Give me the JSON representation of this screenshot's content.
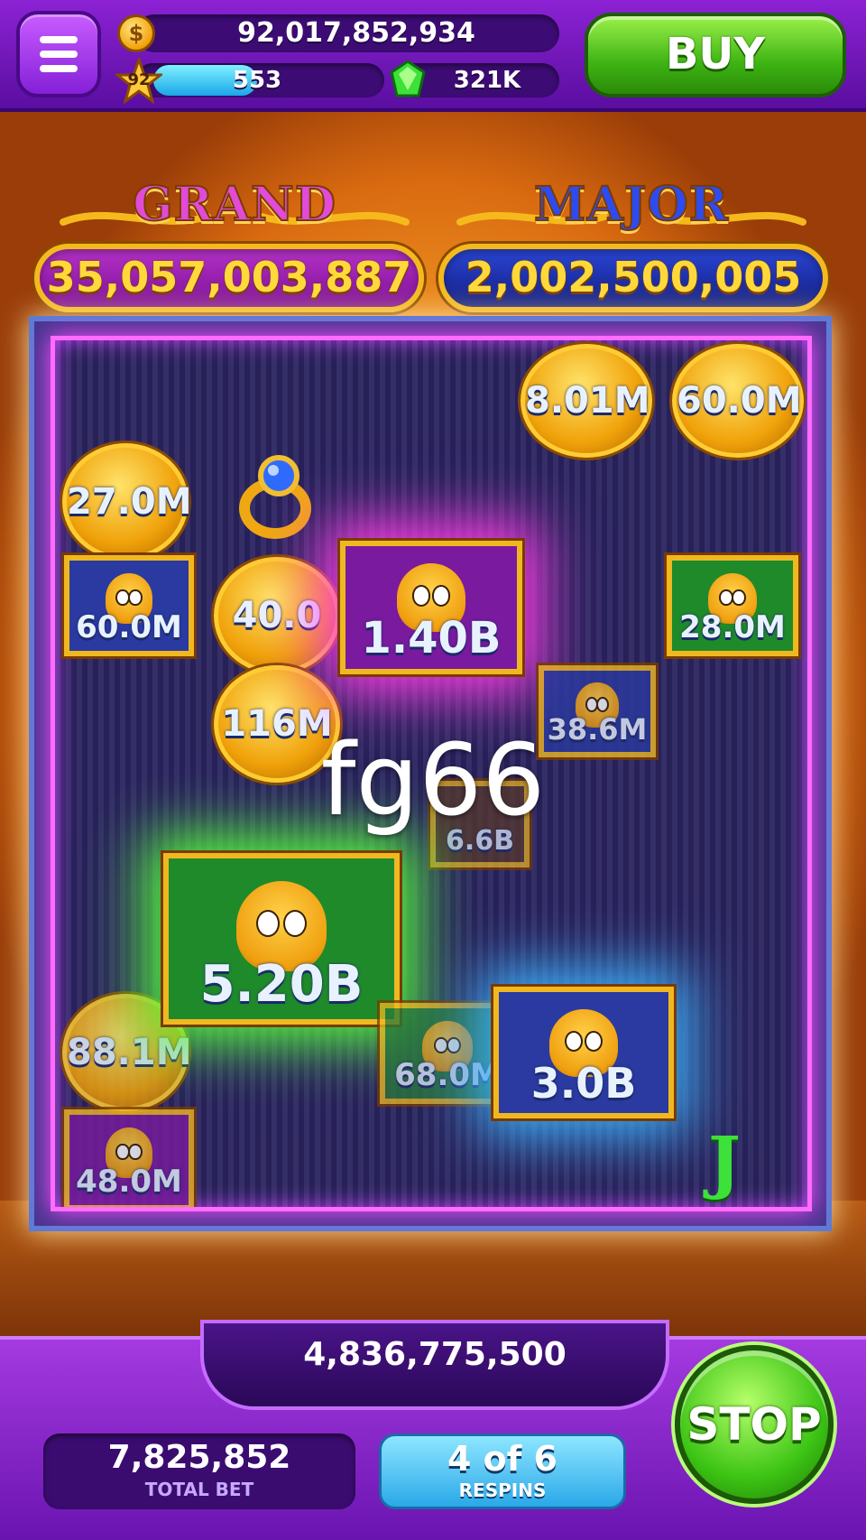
{
  "header": {
    "menu_icon": "hamburger-menu-icon",
    "coin_icon": "coin-icon",
    "coin_symbol": "$",
    "coins": "92,017,852,934",
    "level": "92",
    "xp": "553",
    "xp_progress": 0.45,
    "gem_icon": "green-gem-icon",
    "gems": "321K",
    "buy_label": "BUY"
  },
  "jackpots": {
    "grand_title": "GRAND",
    "grand_value": "35,057,003,887",
    "major_title": "MAJOR",
    "major_value": "2,002,500,005"
  },
  "grid": {
    "coins": [
      {
        "value": "8.01M"
      },
      {
        "value": "60.0M"
      },
      {
        "value": "27.0M"
      },
      {
        "value": "40.0"
      },
      {
        "value": "116M"
      },
      {
        "value": "88.1M"
      }
    ],
    "tiles": [
      {
        "value": "60.0M",
        "character": "wizard"
      },
      {
        "value": "1.40B",
        "character": "queen"
      },
      {
        "value": "28.0M",
        "character": "knight"
      },
      {
        "value": "38.6M",
        "character": "wizard"
      },
      {
        "value": "6.6B",
        "character": "mixed"
      },
      {
        "value": "5.20B",
        "character": "knight"
      },
      {
        "value": "68.0M",
        "character": "queen"
      },
      {
        "value": "3.0B",
        "character": "wizard"
      },
      {
        "value": "48.0M",
        "character": "queen"
      }
    ],
    "ring_icon": "sapphire-ring-icon",
    "j_symbol": "J",
    "watermark": "fg66"
  },
  "footer": {
    "win_amount": "4,836,775,500",
    "total_bet_value": "7,825,852",
    "total_bet_label": "TOTAL BET",
    "respins_value": "4 of 6",
    "respins_label": "RESPINS",
    "stop_label": "STOP"
  },
  "colors": {
    "grand": "#b432c8",
    "major": "#2a46d4",
    "buy": "#3eb414",
    "stop": "#3cc414",
    "frame_glow": "#ff4cff"
  }
}
